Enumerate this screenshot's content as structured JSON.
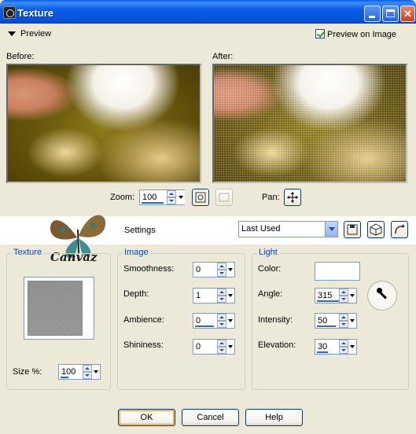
{
  "window": {
    "title": "Texture",
    "minimize": "_",
    "maximize": "□",
    "close": "✕"
  },
  "preview": {
    "toggle_label": "Preview",
    "preview_on_image_label": "Preview on Image",
    "preview_on_image_checked": true,
    "before_label": "Before:",
    "after_label": "After:"
  },
  "zoom": {
    "label": "Zoom:",
    "value": "100"
  },
  "pan": {
    "label": "Pan:"
  },
  "settings": {
    "label": "Settings",
    "selected": "Last Used"
  },
  "logo": {
    "text": "Canvaz"
  },
  "texture_group": {
    "title": "Texture",
    "size_label": "Size %:",
    "size_value": "100"
  },
  "image_group": {
    "title": "Image",
    "fields": [
      {
        "label": "Smoothness:",
        "value": "0"
      },
      {
        "label": "Depth:",
        "value": "1"
      },
      {
        "label": "Ambience:",
        "value": "0"
      },
      {
        "label": "Shininess:",
        "value": "0"
      }
    ]
  },
  "light_group": {
    "title": "Light",
    "color_label": "Color:",
    "color_value": "#ffffff",
    "fields": [
      {
        "label": "Angle:",
        "value": "315"
      },
      {
        "label": "Intensity:",
        "value": "50"
      },
      {
        "label": "Elevation:",
        "value": "30"
      }
    ]
  },
  "buttons": {
    "ok": "OK",
    "cancel": "Cancel",
    "help": "Help"
  },
  "colors": {
    "titlebar": "#0a5ce6",
    "dialog_bg": "#ece9d8",
    "group_title": "#0046d5"
  }
}
